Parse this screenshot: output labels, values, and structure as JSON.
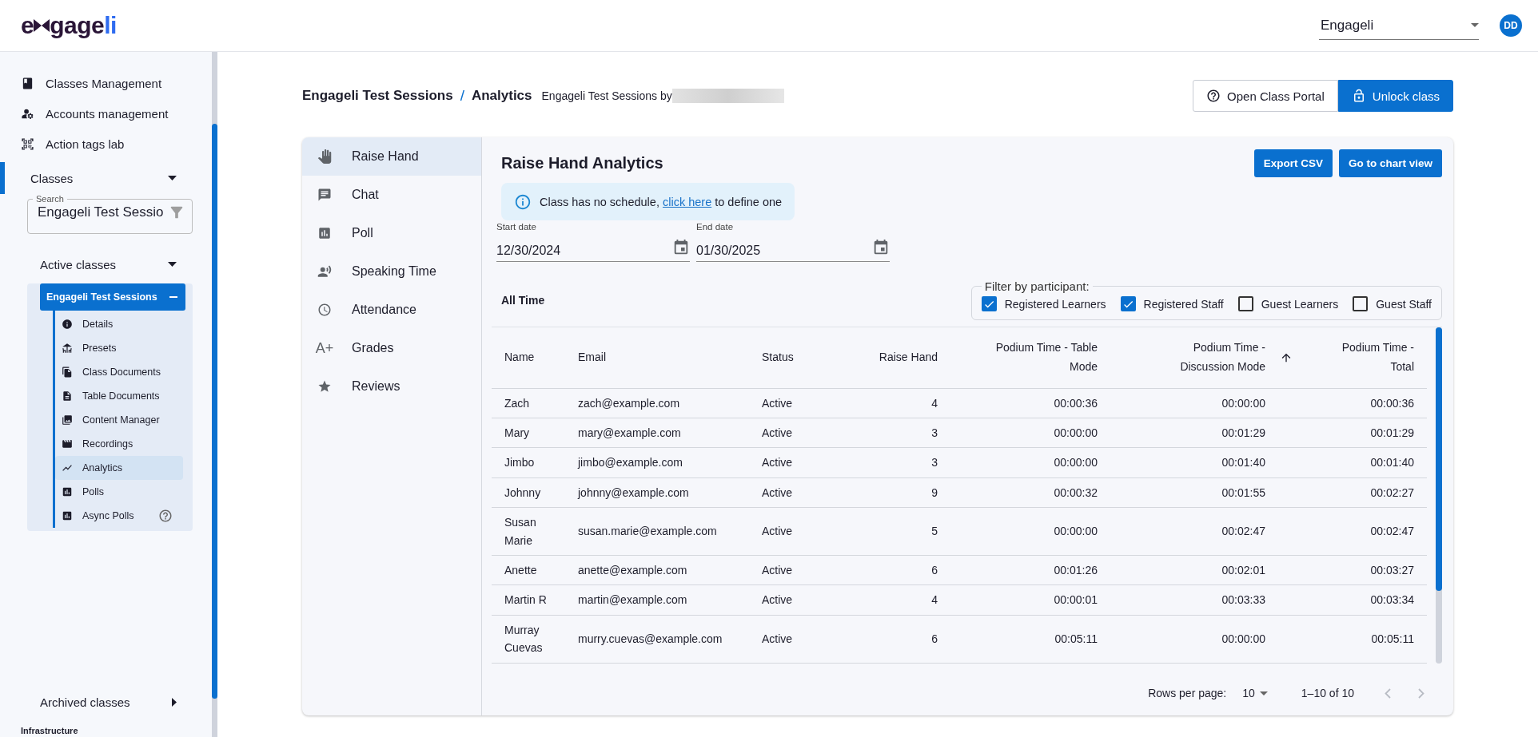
{
  "topbar": {
    "logo": {
      "start": "e",
      "middle": "gage",
      "accent": "li"
    },
    "org_select": "Engageli",
    "avatar": "DD"
  },
  "sidebar": {
    "items": [
      {
        "label": "Classes Management"
      },
      {
        "label": "Accounts management"
      },
      {
        "label": "Action tags lab"
      }
    ],
    "classes": {
      "label": "Classes",
      "expanded": true,
      "search": {
        "label": "Search",
        "value": "Engageli Test Sessio"
      },
      "active": {
        "label": "Active classes",
        "expanded": true
      },
      "class": {
        "name": "Engageli Test Sessions",
        "expanded": true,
        "items": [
          {
            "label": "Details",
            "selected": false,
            "help": false
          },
          {
            "label": "Presets",
            "selected": false,
            "help": false
          },
          {
            "label": "Class Documents",
            "selected": false,
            "help": false
          },
          {
            "label": "Table Documents",
            "selected": false,
            "help": false
          },
          {
            "label": "Content Manager",
            "selected": false,
            "help": false
          },
          {
            "label": "Recordings",
            "selected": false,
            "help": false
          },
          {
            "label": "Analytics",
            "selected": true,
            "help": false
          },
          {
            "label": "Polls",
            "selected": false,
            "help": false
          },
          {
            "label": "Async Polls",
            "selected": false,
            "help": true
          }
        ]
      },
      "archived": {
        "label": "Archived classes",
        "expanded": false
      }
    },
    "footer": "Infrastructure"
  },
  "header": {
    "breadcrumb": [
      "Engageli Test Sessions",
      "Analytics"
    ],
    "separator": "/",
    "subtitle": "Engageli Test Sessions by",
    "buttons": [
      {
        "label": "Open Class Portal",
        "kind": "outline"
      },
      {
        "label": "Unlock class",
        "kind": "primary"
      }
    ]
  },
  "nav": [
    {
      "label": "Raise Hand",
      "selected": true
    },
    {
      "label": "Chat",
      "selected": false
    },
    {
      "label": "Poll",
      "selected": false
    },
    {
      "label": "Speaking Time",
      "selected": false
    },
    {
      "label": "Attendance",
      "selected": false
    },
    {
      "label": "Grades",
      "selected": false,
      "glyph": "A+"
    },
    {
      "label": "Reviews",
      "selected": false
    }
  ],
  "panel": {
    "title": "Raise Hand Analytics",
    "actions": [
      "Export CSV",
      "Go to chart view"
    ],
    "banner": {
      "before": "Class has no schedule, ",
      "link": "click here",
      "after": " to define one"
    },
    "dates": [
      {
        "label": "Start date",
        "value": "12/30/2024"
      },
      {
        "label": "End date",
        "value": "01/30/2025"
      }
    ],
    "range_label": "All Time",
    "filter": {
      "legend": "Filter by participant:",
      "options": [
        {
          "label": "Registered Learners",
          "checked": true
        },
        {
          "label": "Registered Staff",
          "checked": true
        },
        {
          "label": "Guest Learners",
          "checked": false
        },
        {
          "label": "Guest Staff",
          "checked": false
        }
      ]
    },
    "table": {
      "columns": [
        {
          "label": "Name",
          "sorted": false
        },
        {
          "label": "Email",
          "sorted": false
        },
        {
          "label": "Status",
          "sorted": false
        },
        {
          "label": "Raise Hand",
          "sorted": false
        },
        {
          "label": "Podium Time - Table Mode",
          "sorted": false
        },
        {
          "label": "Podium Time - Discussion Mode",
          "sorted": false
        },
        {
          "label": "Podium Time - Total",
          "sorted": true
        }
      ],
      "rows": [
        [
          "Zach",
          "zach@example.com",
          "Active",
          "4",
          "00:00:36",
          "00:00:00",
          "00:00:36"
        ],
        [
          "Mary",
          "mary@example.com",
          "Active",
          "3",
          "00:00:00",
          "00:01:29",
          "00:01:29"
        ],
        [
          "Jimbo",
          "jimbo@example.com",
          "Active",
          "3",
          "00:00:00",
          "00:01:40",
          "00:01:40"
        ],
        [
          "Johnny",
          "johnny@example.com",
          "Active",
          "9",
          "00:00:32",
          "00:01:55",
          "00:02:27"
        ],
        [
          "Susan Marie",
          "susan.marie@example.com",
          "Active",
          "5",
          "00:00:00",
          "00:02:47",
          "00:02:47"
        ],
        [
          "Anette",
          "anette@example.com",
          "Active",
          "6",
          "00:01:26",
          "00:02:01",
          "00:03:27"
        ],
        [
          "Martin R",
          "martin@example.com",
          "Active",
          "4",
          "00:00:01",
          "00:03:33",
          "00:03:34"
        ],
        [
          "Murray Cuevas",
          "murry.cuevas@example.com",
          "Active",
          "6",
          "00:05:11",
          "00:00:00",
          "00:05:11"
        ]
      ]
    },
    "pagination": {
      "rows_label": "Rows per page:",
      "rows_value": "10",
      "range": "1–10 of 10",
      "prev_disabled": true,
      "next_disabled": true
    }
  }
}
